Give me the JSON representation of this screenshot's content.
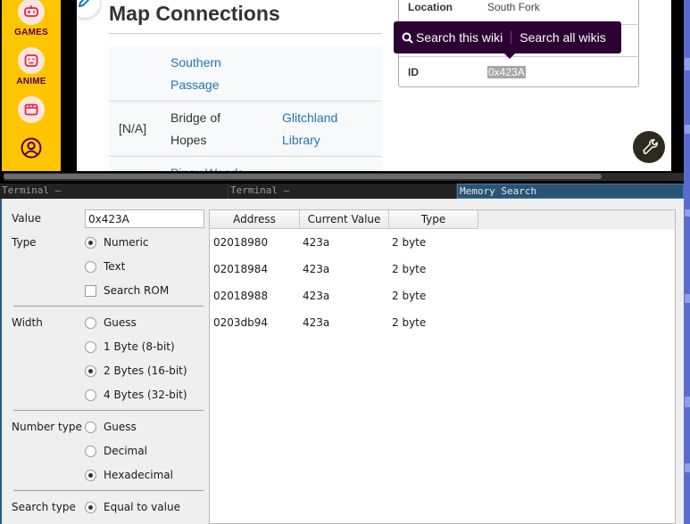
{
  "browser": {
    "rail": {
      "items": [
        {
          "label": "GAMES",
          "icon": "game-controller-icon"
        },
        {
          "label": "ANIME",
          "icon": "anime-face-icon"
        },
        {
          "label": "",
          "icon": "clapperboard-icon"
        },
        {
          "label": "",
          "icon": "user-account-icon"
        }
      ]
    },
    "page": {
      "title": "Map Connections",
      "connections": [
        {
          "left": "",
          "middle": "Southern Passage",
          "middle_is_link": true,
          "right": ""
        },
        {
          "left": "[N/A]",
          "middle": "Bridge of Hopes",
          "middle_is_link": false,
          "right": "Glitchland Library"
        },
        {
          "left": "",
          "middle": "Piney Woods",
          "middle_is_link": true,
          "right": ""
        }
      ]
    },
    "infobox": {
      "rows": [
        {
          "label": "Location",
          "value": "South Fork"
        },
        {
          "label": "",
          "value": ""
        },
        {
          "label": "ID",
          "value": "0x423A"
        }
      ]
    },
    "search_tooltip": {
      "search_this": "Search this wiki",
      "search_all": "Search all wikis"
    }
  },
  "tabs": [
    {
      "label": "Terminal —",
      "active": false
    },
    {
      "label": "Terminal —",
      "active": false
    },
    {
      "label": "Memory Search",
      "active": true
    }
  ],
  "memory_search": {
    "value_label": "Value",
    "value": "0x423A",
    "type_label": "Type",
    "type_options": [
      {
        "label": "Numeric",
        "checked": true
      },
      {
        "label": "Text",
        "checked": false
      }
    ],
    "search_rom_label": "Search ROM",
    "search_rom_checked": false,
    "width_label": "Width",
    "width_options": [
      {
        "label": "Guess",
        "checked": false
      },
      {
        "label": "1 Byte (8-bit)",
        "checked": false
      },
      {
        "label": "2 Bytes (16-bit)",
        "checked": true
      },
      {
        "label": "4 Bytes (32-bit)",
        "checked": false
      }
    ],
    "number_type_label": "Number type",
    "number_type_options": [
      {
        "label": "Guess",
        "checked": false
      },
      {
        "label": "Decimal",
        "checked": false
      },
      {
        "label": "Hexadecimal",
        "checked": true
      }
    ],
    "search_type_label": "Search type",
    "search_type_options": [
      {
        "label": "Equal to value",
        "checked": true
      }
    ],
    "results": {
      "columns": [
        "Address",
        "Current Value",
        "Type"
      ],
      "rows": [
        {
          "address": "02018980",
          "value": "423a",
          "type": "2 byte"
        },
        {
          "address": "02018984",
          "value": "423a",
          "type": "2 byte"
        },
        {
          "address": "02018988",
          "value": "423a",
          "type": "2 byte"
        },
        {
          "address": "0203db94",
          "value": "423a",
          "type": "2 byte"
        }
      ]
    }
  },
  "colors": {
    "fandom_rail": "#ffc500",
    "tooltip_bg": "#2c0033",
    "link": "#1f75b8",
    "active_tab": "#2a5474"
  }
}
